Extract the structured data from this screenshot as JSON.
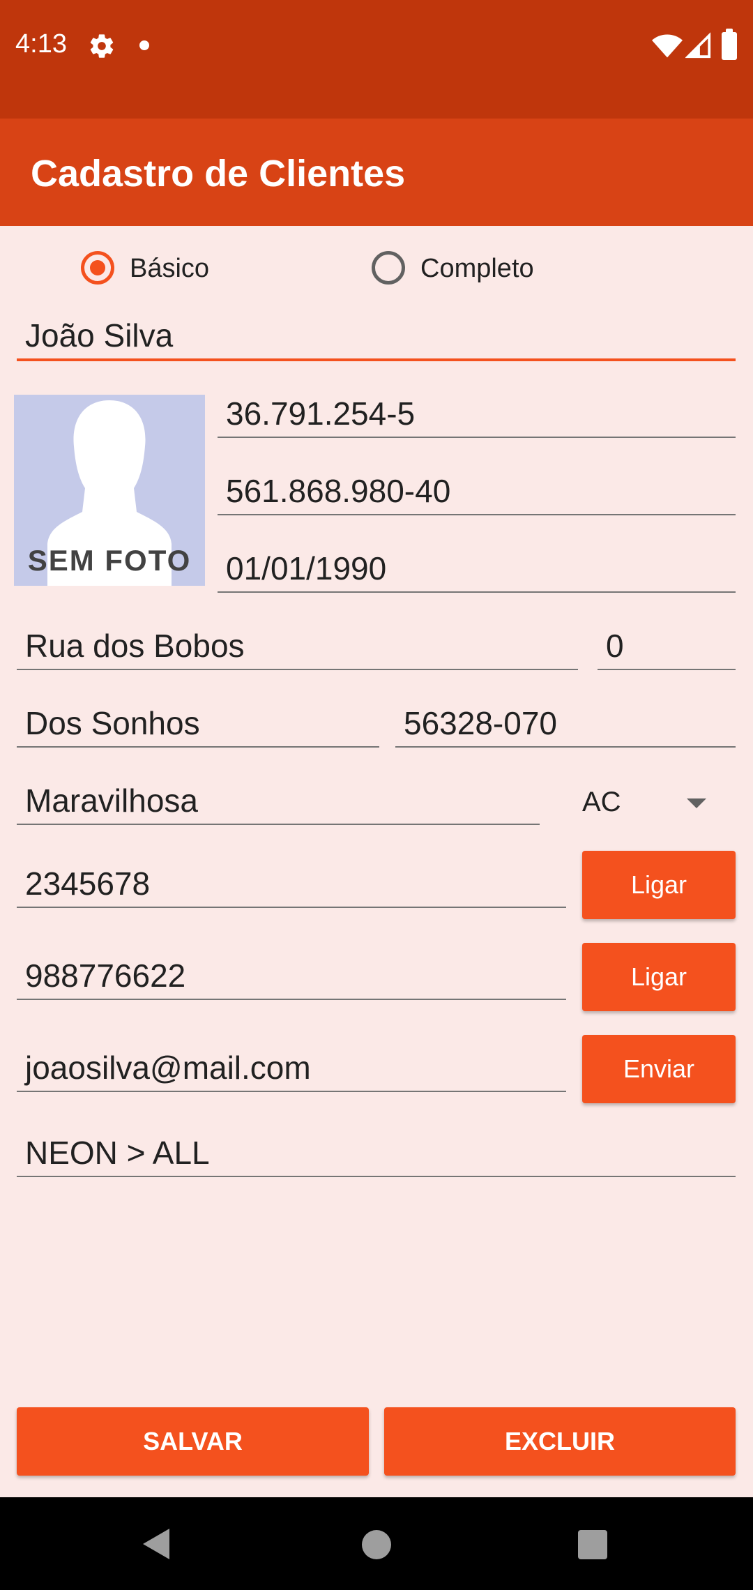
{
  "status_bar": {
    "time": "4:13",
    "icons": [
      "gear-icon",
      "dot-icon",
      "wifi-icon",
      "signal-icon",
      "battery-icon"
    ]
  },
  "app_bar": {
    "title": "Cadastro de Clientes"
  },
  "mode": {
    "options": [
      "Básico",
      "Completo"
    ],
    "selected": "Básico"
  },
  "form": {
    "name": "João Silva",
    "rg": "36.791.254-5",
    "cpf": "561.868.980-40",
    "birth_date": "01/01/1990",
    "street": "Rua dos Bobos",
    "number": "0",
    "neighborhood": "Dos Sonhos",
    "cep": "56328-070",
    "city": "Maravilhosa",
    "state": "AC",
    "phone": "2345678",
    "mobile": "988776622",
    "email": "joaosilva@mail.com",
    "notes": "NEON > ALL"
  },
  "photo": {
    "placeholder_text": "SEM FOTO"
  },
  "buttons": {
    "call_phone": "Ligar",
    "call_mobile": "Ligar",
    "send_email": "Enviar",
    "save": "SALVAR",
    "delete": "EXCLUIR"
  },
  "colors": {
    "status_bar": "#BF360C",
    "app_bar": "#D84315",
    "accent": "#F4511E",
    "background": "#FBE9E7"
  }
}
